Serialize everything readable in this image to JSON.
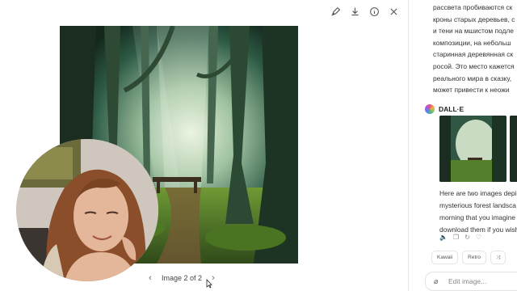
{
  "viewer": {
    "toolbar": {
      "edit_icon": "edit-image-icon",
      "download_icon": "download-icon",
      "info_icon": "info-icon",
      "close_icon": "close-icon"
    },
    "pager": {
      "label": "Image 2 of 2",
      "prev": "‹",
      "next": "›"
    }
  },
  "sidebar": {
    "prompt_lines": [
      "рассвета пробиваются ск",
      "кроны старых деревьев, с",
      "и тени на мшистом подле",
      "композиции, на небольш",
      "старинная деревянная ск",
      "росой. Это место кажется",
      "реального мира в сказку,",
      "может привести к неожи"
    ],
    "author": "DALL·E",
    "response_lines": [
      "Here are two images depi",
      "mysterious forest landsca",
      "morning that you imagine",
      "download them if you wish"
    ],
    "chips": [
      "Kawaii",
      "Retro",
      "⤨"
    ],
    "edit_placeholder": "Edit image..."
  },
  "colors": {
    "forest_dark": "#1f3a2a",
    "forest_moss": "#5f8a2e",
    "forest_mist": "#cfe0c8",
    "divider": "#e6e6e6"
  }
}
